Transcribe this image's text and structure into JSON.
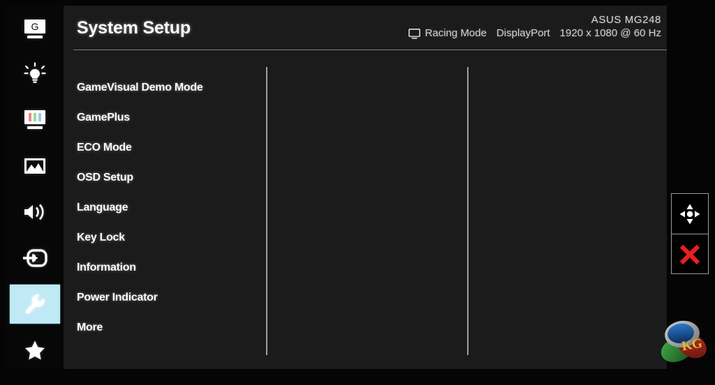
{
  "osd": {
    "header": {
      "title": "System Setup",
      "model": "ASUS MG248",
      "display_icon": "monitor-icon",
      "preset_mode": "Racing Mode",
      "input_source": "DisplayPort",
      "resolution": "1920 x 1080 @ 60 Hz"
    },
    "sidebar": {
      "items": [
        {
          "label": "GameVisual",
          "icon": "gamevisual-monitor-g-icon",
          "active": false
        },
        {
          "label": "Blue Light Filter",
          "icon": "lightbulb-icon",
          "active": false
        },
        {
          "label": "Color",
          "icon": "color-bars-monitor-icon",
          "active": false
        },
        {
          "label": "Image",
          "icon": "picture-icon",
          "active": false
        },
        {
          "label": "Sound",
          "icon": "speaker-icon",
          "active": false
        },
        {
          "label": "Input Select",
          "icon": "input-arrow-icon",
          "active": false
        },
        {
          "label": "System Setup",
          "icon": "wrench-icon",
          "active": true
        },
        {
          "label": "MyFavorite",
          "icon": "star-icon",
          "active": false
        }
      ]
    },
    "menu": {
      "items": [
        {
          "label": "GameVisual Demo Mode"
        },
        {
          "label": "GamePlus"
        },
        {
          "label": "ECO Mode"
        },
        {
          "label": "OSD Setup"
        },
        {
          "label": "Language"
        },
        {
          "label": "Key Lock"
        },
        {
          "label": "Information"
        },
        {
          "label": "Power Indicator"
        },
        {
          "label": "More"
        }
      ]
    },
    "controls": [
      {
        "name": "navigate-button",
        "icon": "four-way-arrows-icon",
        "label": "Navigate"
      },
      {
        "name": "close-button",
        "icon": "close-x-icon",
        "label": "Close"
      }
    ]
  },
  "watermark": {
    "text": "KG",
    "name": "kitguru-logo"
  },
  "colors": {
    "highlight": "#bfe9f4",
    "panel_bg": "#1b1b1b",
    "rail_bg": "#070707",
    "text": "#fbfbfb",
    "close_red": "#e81f1f",
    "rule": "#8f8f8f"
  }
}
